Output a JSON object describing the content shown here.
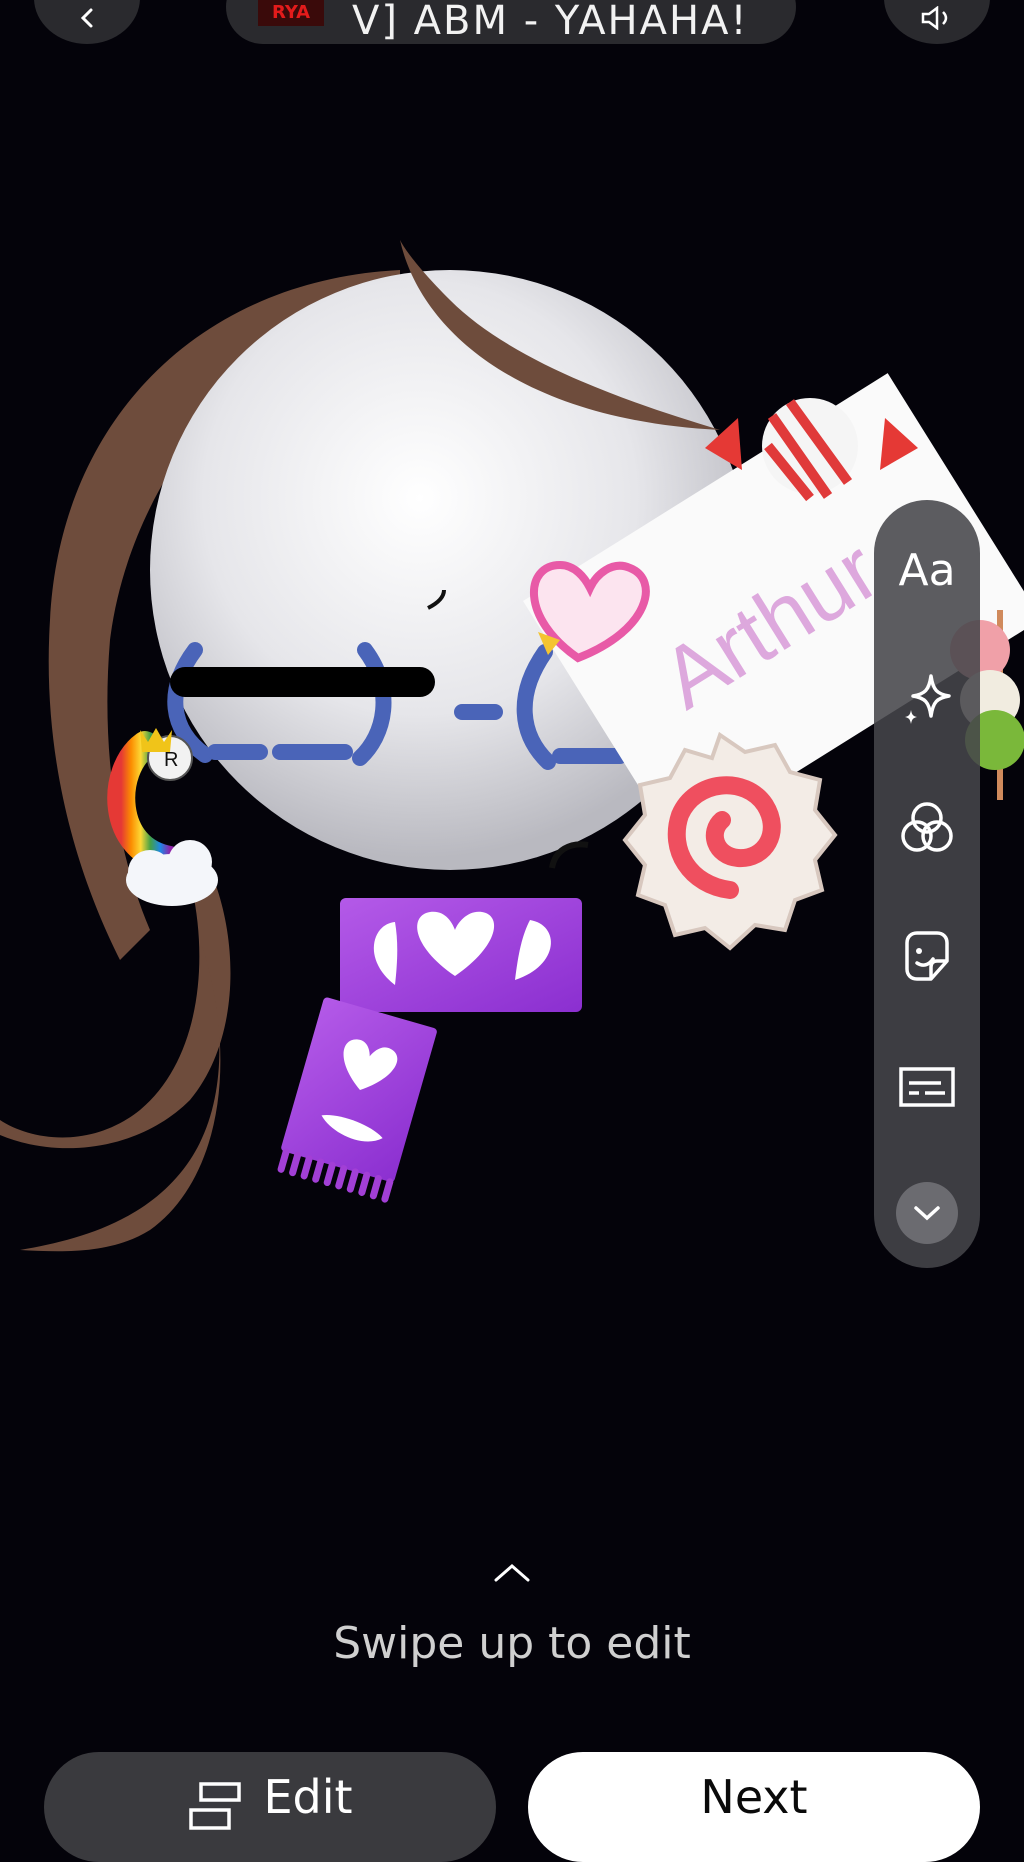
{
  "top_bar": {
    "music_cover_text": "RYA",
    "music_title": "V] ABM - YAHAHA!"
  },
  "canvas": {
    "sticker_text": "Arthur",
    "kaomoji": "(-__-)-(__-)"
  },
  "tool_rail": {
    "text_tool_label": "Aa"
  },
  "swipe_hint": "Swipe up to edit",
  "buttons": {
    "edit_label": "Edit",
    "next_label": "Next"
  },
  "colors": {
    "background": "#04030a",
    "hair": "#6e4c3c",
    "face": "#e8e8ec",
    "kaomoji_blue": "#4a64b8",
    "scarf_purple": "#a23fd6",
    "rail": "#46464a"
  },
  "icons": [
    "back-icon",
    "speaker-icon",
    "sparkle-icon",
    "filters-icon",
    "sticker-icon",
    "captions-icon",
    "chevron-down-icon",
    "chevron-up-icon",
    "edit-layout-icon"
  ]
}
